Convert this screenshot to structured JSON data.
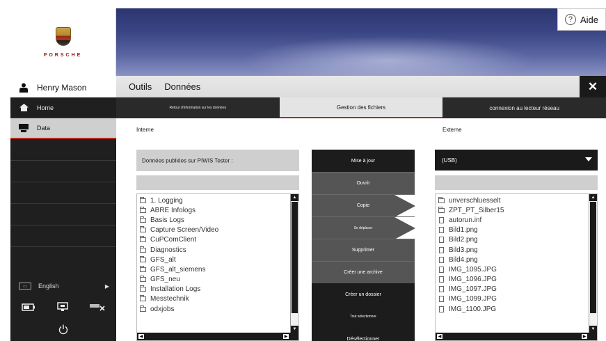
{
  "brand": {
    "wordmark": "PORSCHE"
  },
  "help": {
    "label": "Aide",
    "icon": "help-circle-icon"
  },
  "user": {
    "name": "Henry Mason",
    "icon": "user-icon"
  },
  "sidebar": {
    "items": [
      {
        "label": "Home",
        "icon": "home-icon",
        "active": false
      },
      {
        "label": "Data",
        "icon": "monitor-icon",
        "active": true
      }
    ],
    "language": {
      "label": "English",
      "icon": "flag-icon"
    },
    "tools": [
      "battery-icon",
      "network-icon",
      "disconnect-icon"
    ],
    "power_icon": "power-icon"
  },
  "menubar": {
    "items": [
      "Outils",
      "Données"
    ],
    "close_icon": "close-icon"
  },
  "tabs": [
    {
      "label": "Retour d'information sur les données",
      "active": false
    },
    {
      "label": "Gestion des fichiers",
      "active": true
    },
    {
      "label": "connexion au lecteur réseau",
      "active": false
    }
  ],
  "internal": {
    "title": "Interne",
    "source_label": "Données publiées sur PIWIS Tester :",
    "files": [
      "1. Logging",
      "ABRE Infologs",
      "Basis Logs",
      "Capture Screen/Video",
      "CuPComClient",
      "Diagnostics",
      "GFS_alt",
      "GFS_alt_siemens",
      "GFS_neu",
      "Installation Logs",
      "Messtechnik",
      "odxjobs"
    ]
  },
  "external": {
    "title": "Externe",
    "device": "(USB)",
    "files": [
      {
        "name": "unverschluesselt",
        "type": "folder"
      },
      {
        "name": "ZPT_PT_Silber15",
        "type": "folder"
      },
      {
        "name": "autorun.inf",
        "type": "file"
      },
      {
        "name": "Bild1.png",
        "type": "file"
      },
      {
        "name": "Bild2.png",
        "type": "file"
      },
      {
        "name": "Bild3.png",
        "type": "file"
      },
      {
        "name": "Bild4.png",
        "type": "file"
      },
      {
        "name": "IMG_1095.JPG",
        "type": "file"
      },
      {
        "name": "IMG_1096.JPG",
        "type": "file"
      },
      {
        "name": "IMG_1097.JPG",
        "type": "file"
      },
      {
        "name": "IMG_1099.JPG",
        "type": "file"
      },
      {
        "name": "IMG_1100.JPG",
        "type": "file"
      }
    ]
  },
  "actions": [
    {
      "label": "Mise à jour",
      "style": "dark"
    },
    {
      "label": "Ouvrir",
      "style": "mid"
    },
    {
      "label": "Copie",
      "style": "mid",
      "arrow": true
    },
    {
      "label": "Se déplacer",
      "style": "mid",
      "arrow": true,
      "small": true
    },
    {
      "label": "Supprimer",
      "style": "mid"
    },
    {
      "label": "Créer une archive",
      "style": "mid"
    },
    {
      "label": "Créer un dossier",
      "style": "dark"
    },
    {
      "label": "Tout sélectionner",
      "style": "dark",
      "small": true
    },
    {
      "label": "Désélectionner",
      "style": "dark"
    }
  ],
  "colors": {
    "accent": "#b12a1f",
    "dark": "#1c1c1c",
    "mid": "#555555",
    "banner": "#3a4584"
  }
}
